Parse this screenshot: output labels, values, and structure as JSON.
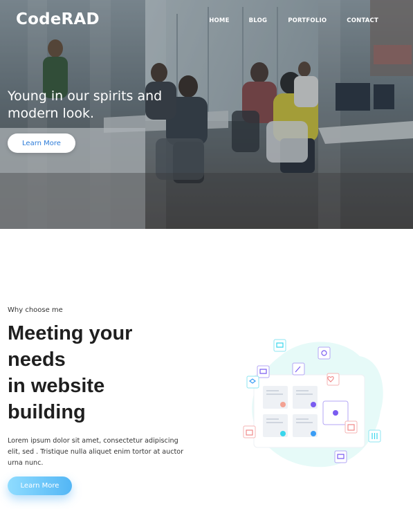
{
  "brand": {
    "name": "CodeRAD"
  },
  "nav": {
    "items": [
      {
        "label": "HOME"
      },
      {
        "label": "BLOG"
      },
      {
        "label": "PORTFOLIO"
      },
      {
        "label": "CONTACT"
      }
    ]
  },
  "hero": {
    "title": "Young in our spirits and modern look.",
    "button_label": "Learn More"
  },
  "feature": {
    "eyebrow": "Why choose me",
    "title_lines": [
      "Meeting your",
      "needs",
      "in website",
      "building"
    ],
    "description": "Lorem ipsum dolor sit amet, consectetur adipiscing elit, sed . Tristique nulla aliquet enim tortor at auctor urna nunc.",
    "button_label": "Learn More"
  },
  "colors": {
    "hero_button_text": "#2b7bd8",
    "feature_button_start": "#8fdcff",
    "feature_button_end": "#53b6f5"
  }
}
